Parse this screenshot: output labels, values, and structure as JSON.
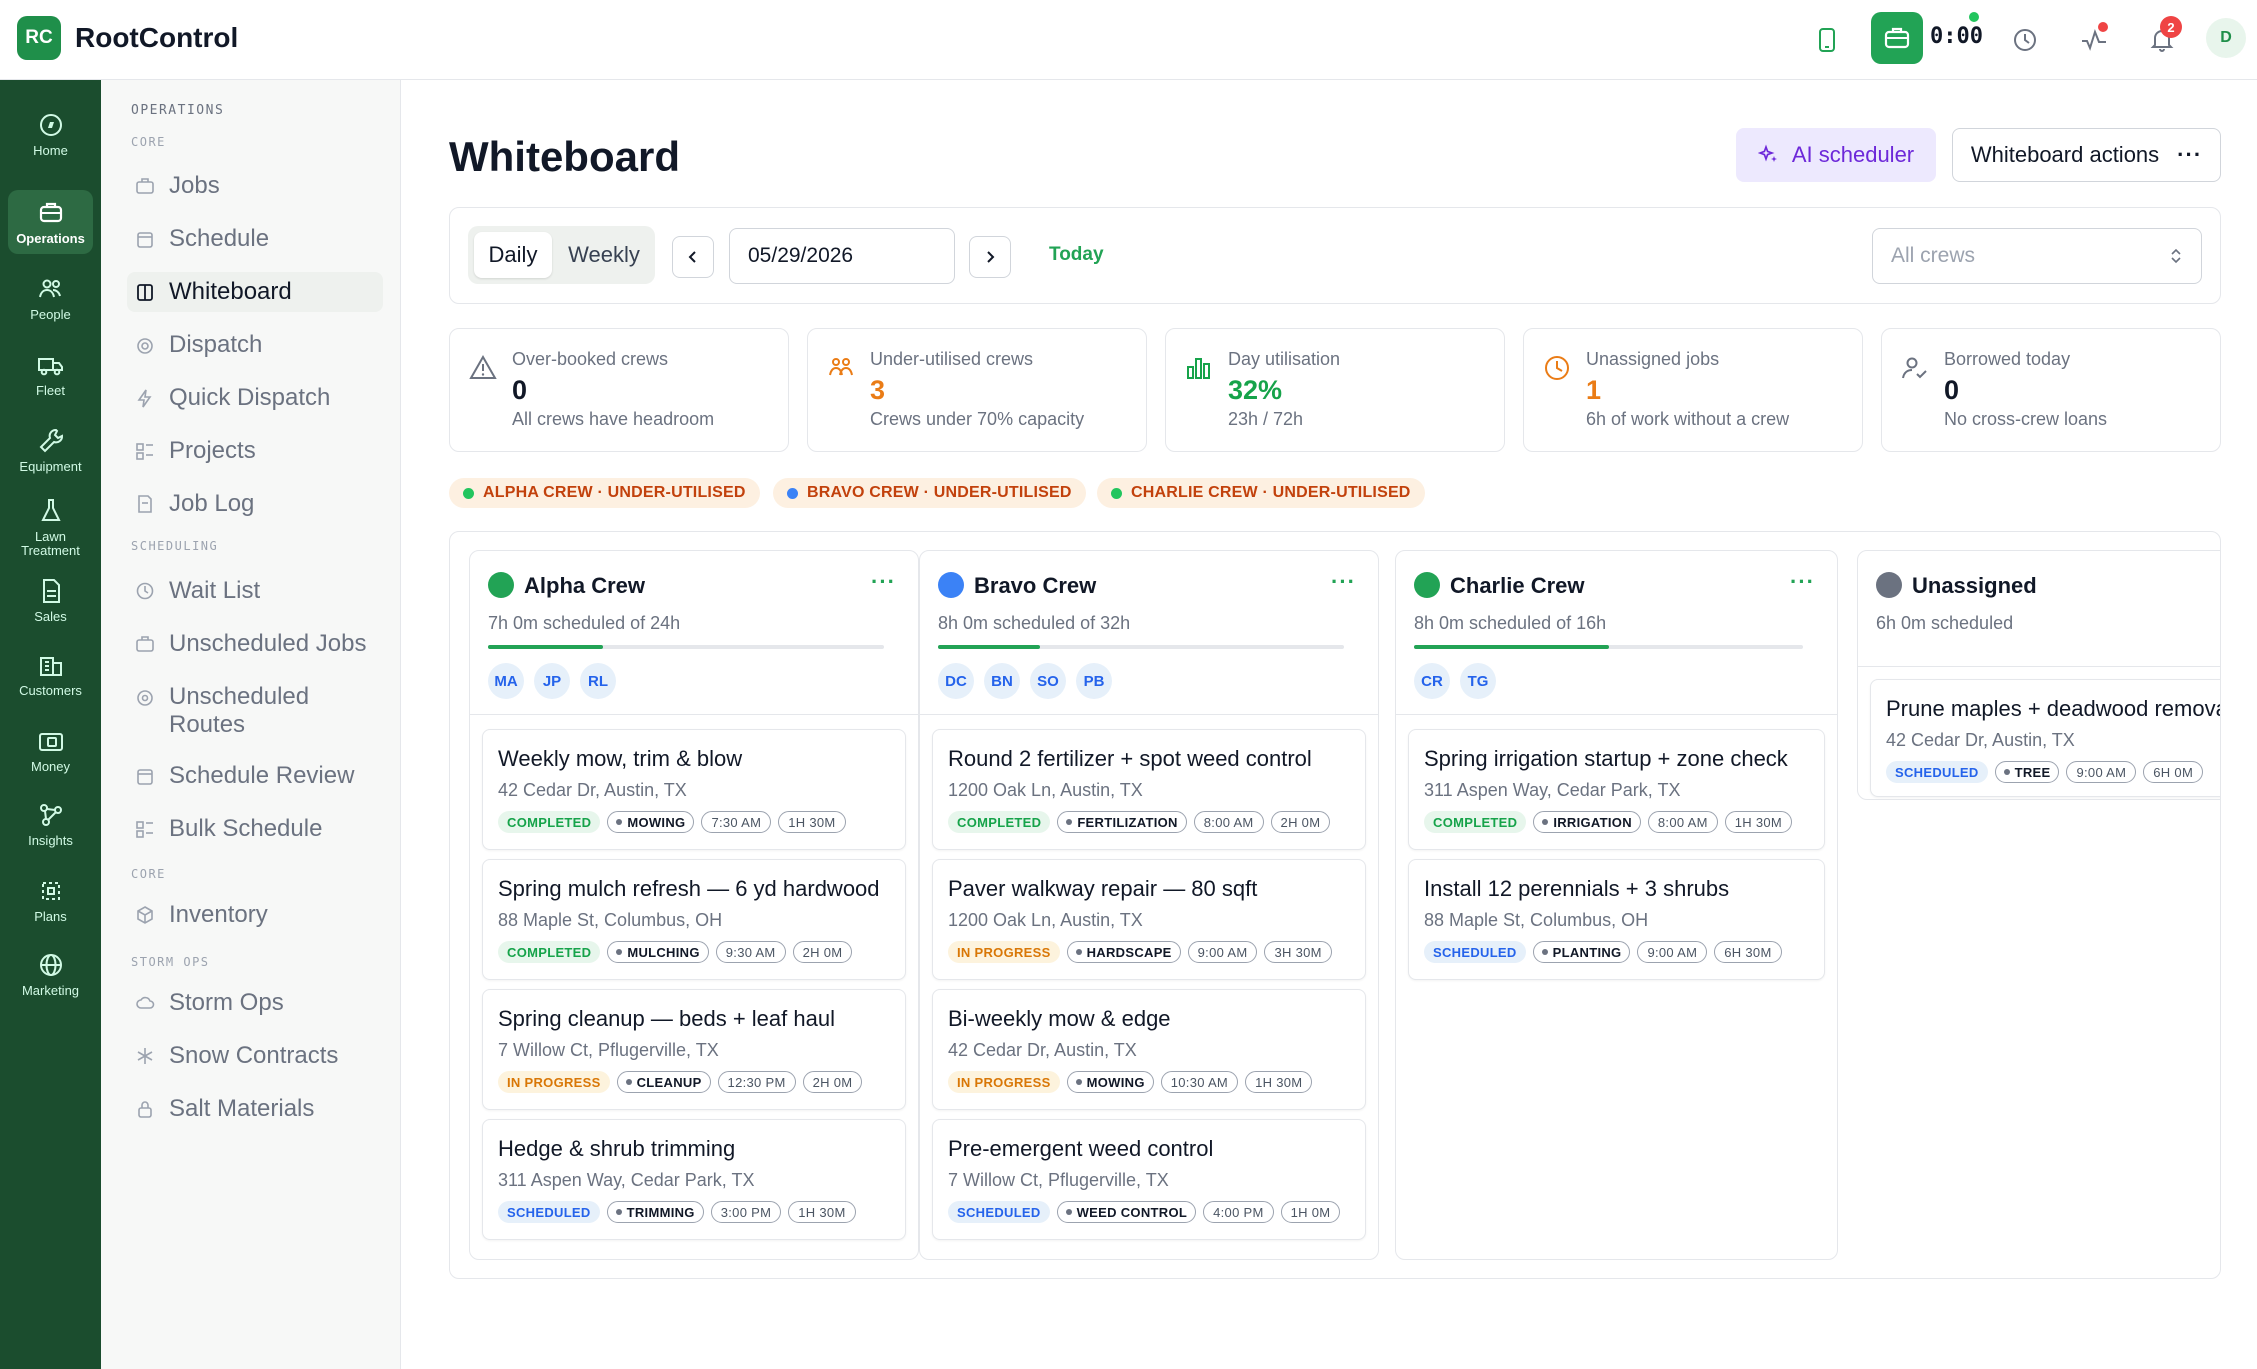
{
  "app": {
    "logo": "RC",
    "title": "RootControl"
  },
  "topbar": {
    "timer": "0:00",
    "notifications": "2",
    "user_initial": "D"
  },
  "rail": [
    {
      "label": "Home",
      "icon": "compass-icon"
    },
    {
      "label": "Operations",
      "icon": "briefcase-icon"
    },
    {
      "label": "People",
      "icon": "people-icon"
    },
    {
      "label": "Fleet",
      "icon": "truck-icon"
    },
    {
      "label": "Equipment",
      "icon": "wrench-icon"
    },
    {
      "label": "Lawn Treatment",
      "icon": "flask-icon"
    },
    {
      "label": "Sales",
      "icon": "document-icon"
    },
    {
      "label": "Customers",
      "icon": "building-icon"
    },
    {
      "label": "Money",
      "icon": "wallet-icon"
    },
    {
      "label": "Insights",
      "icon": "nodes-icon"
    },
    {
      "label": "Plans",
      "icon": "target-icon"
    },
    {
      "label": "Marketing",
      "icon": "globe-icon"
    }
  ],
  "sidebar": {
    "section": "OPERATIONS",
    "core_label": "CORE",
    "scheduling_label": "SCHEDULING",
    "core2_label": "CORE",
    "storm_label": "STORM OPS",
    "items": [
      {
        "label": "Jobs"
      },
      {
        "label": "Schedule"
      },
      {
        "label": "Whiteboard"
      },
      {
        "label": "Dispatch"
      },
      {
        "label": "Quick Dispatch"
      },
      {
        "label": "Projects"
      },
      {
        "label": "Job Log"
      },
      {
        "label": "Wait List"
      },
      {
        "label": "Unscheduled Jobs"
      },
      {
        "label": "Unscheduled Routes"
      },
      {
        "label": "Schedule Review"
      },
      {
        "label": "Bulk Schedule"
      },
      {
        "label": "Inventory"
      },
      {
        "label": "Storm Ops"
      },
      {
        "label": "Snow Contracts"
      },
      {
        "label": "Salt Materials"
      }
    ]
  },
  "page": {
    "title": "Whiteboard",
    "ai_button": "AI scheduler",
    "actions_button": "Whiteboard actions",
    "view_daily": "Daily",
    "view_weekly": "Weekly",
    "date": "05/29/2026",
    "today": "Today",
    "crew_filter": "All crews"
  },
  "stats": [
    {
      "label": "Over-booked crews",
      "value": "0",
      "sub": "All crews have headroom",
      "color": "#111827"
    },
    {
      "label": "Under-utilised crews",
      "value": "3",
      "sub": "Crews under 70% capacity",
      "color": "#ea7c16"
    },
    {
      "label": "Day utilisation",
      "value": "32%",
      "sub": "23h / 72h",
      "color": "#16a34a"
    },
    {
      "label": "Unassigned jobs",
      "value": "1",
      "sub": "6h of work without a crew",
      "color": "#ea7c16"
    },
    {
      "label": "Borrowed today",
      "value": "0",
      "sub": "No cross-crew loans",
      "color": "#111827"
    }
  ],
  "alerts": [
    {
      "label": "ALPHA CREW · UNDER-UTILISED",
      "color": "#22c55e"
    },
    {
      "label": "BRAVO CREW · UNDER-UTILISED",
      "color": "#3b82f6"
    },
    {
      "label": "CHARLIE CREW · UNDER-UTILISED",
      "color": "#22c55e"
    }
  ],
  "crews": [
    {
      "name": "Alpha Crew",
      "color": "#22a355",
      "scheduled": "7h 0m scheduled of 24h",
      "utilisation": 0.29,
      "members": [
        "MA",
        "JP",
        "RL"
      ],
      "jobs": [
        {
          "title": "Weekly mow, trim & blow",
          "address": "42 Cedar Dr, Austin, TX",
          "status": "COMPLETED",
          "category": "MOWING",
          "time": "7:30 AM",
          "duration": "1H 30M"
        },
        {
          "title": "Spring mulch refresh — 6 yd hardwood",
          "address": "88 Maple St, Columbus, OH",
          "status": "COMPLETED",
          "category": "MULCHING",
          "time": "9:30 AM",
          "duration": "2H 0M"
        },
        {
          "title": "Spring cleanup — beds + leaf haul",
          "address": "7 Willow Ct, Pflugerville, TX",
          "status": "IN PROGRESS",
          "category": "CLEANUP",
          "time": "12:30 PM",
          "duration": "2H 0M"
        },
        {
          "title": "Hedge & shrub trimming",
          "address": "311 Aspen Way, Cedar Park, TX",
          "status": "SCHEDULED",
          "category": "TRIMMING",
          "time": "3:00 PM",
          "duration": "1H 30M"
        }
      ]
    },
    {
      "name": "Bravo Crew",
      "color": "#3b82f6",
      "scheduled": "8h 0m scheduled of 32h",
      "utilisation": 0.25,
      "members": [
        "DC",
        "BN",
        "SO",
        "PB"
      ],
      "jobs": [
        {
          "title": "Round 2 fertilizer + spot weed control",
          "address": "1200 Oak Ln, Austin, TX",
          "status": "COMPLETED",
          "category": "FERTILIZATION",
          "time": "8:00 AM",
          "duration": "2H 0M"
        },
        {
          "title": "Paver walkway repair — 80 sqft",
          "address": "1200 Oak Ln, Austin, TX",
          "status": "IN PROGRESS",
          "category": "HARDSCAPE",
          "time": "9:00 AM",
          "duration": "3H 30M"
        },
        {
          "title": "Bi-weekly mow & edge",
          "address": "42 Cedar Dr, Austin, TX",
          "status": "IN PROGRESS",
          "category": "MOWING",
          "time": "10:30 AM",
          "duration": "1H 30M"
        },
        {
          "title": "Pre-emergent weed control",
          "address": "7 Willow Ct, Pflugerville, TX",
          "status": "SCHEDULED",
          "category": "WEED CONTROL",
          "time": "4:00 PM",
          "duration": "1H 0M"
        }
      ]
    },
    {
      "name": "Charlie Crew",
      "color": "#22a355",
      "scheduled": "8h 0m scheduled of 16h",
      "utilisation": 0.5,
      "members": [
        "CR",
        "TG"
      ],
      "jobs": [
        {
          "title": "Spring irrigation startup + zone check",
          "address": "311 Aspen Way, Cedar Park, TX",
          "status": "COMPLETED",
          "category": "IRRIGATION",
          "time": "8:00 AM",
          "duration": "1H 30M"
        },
        {
          "title": "Install 12 perennials + 3 shrubs",
          "address": "88 Maple St, Columbus, OH",
          "status": "SCHEDULED",
          "category": "PLANTING",
          "time": "9:00 AM",
          "duration": "6H 30M"
        }
      ]
    },
    {
      "name": "Unassigned",
      "color": "#6b7280",
      "scheduled": "6h 0m scheduled",
      "members": [],
      "jobs": [
        {
          "title": "Prune maples + deadwood removal",
          "address": "42 Cedar Dr, Austin, TX",
          "status": "SCHEDULED",
          "category": "TREE",
          "time": "9:00 AM",
          "duration": "6H 0M"
        }
      ]
    }
  ]
}
